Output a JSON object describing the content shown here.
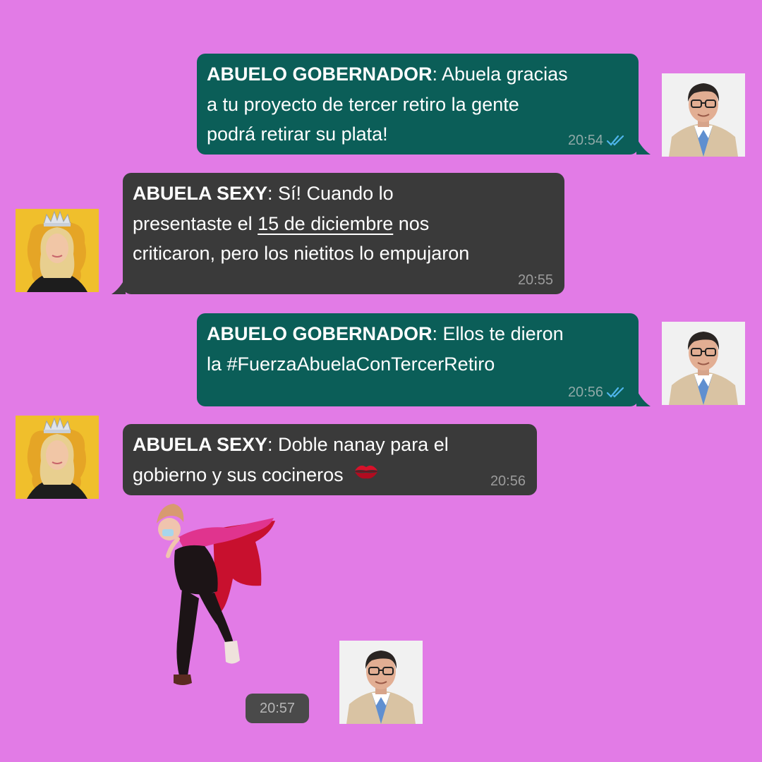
{
  "colors": {
    "background": "#e27be6",
    "outgoing_bubble": "#0b5e58",
    "incoming_bubble": "#3a3a3a",
    "read_ticks": "#4fb6ec"
  },
  "messages": [
    {
      "direction": "out",
      "sender": "ABUELO GOBERNADOR",
      "text_lines": [
        "Abuela gracias",
        "a tu proyecto de tercer retiro la gente",
        "podrá retirar su plata!"
      ],
      "time": "20:54",
      "status_icon": "double-check-read-icon"
    },
    {
      "direction": "in",
      "sender": "ABUELA SEXY",
      "text_lines": [
        "Sí! Cuando lo",
        "presentaste el",
        "15 de diciembre",
        "nos",
        "criticaron, pero los nietitos lo empujaron"
      ],
      "time": "20:55"
    },
    {
      "direction": "out",
      "sender": "ABUELO GOBERNADOR",
      "text_lines": [
        "Ellos te dieron",
        "la #FuerzaAbuelaConTercerRetiro"
      ],
      "time": "20:56",
      "status_icon": "double-check-read-icon"
    },
    {
      "direction": "in",
      "sender": "ABUELA SEXY",
      "text_lines": [
        "Doble nanay para el",
        "gobierno y sus cocineros"
      ],
      "emoji": "kiss-mark-icon",
      "time": "20:56"
    }
  ],
  "sticker": {
    "icon": "flying-superhero-sticker",
    "time": "20:57"
  }
}
